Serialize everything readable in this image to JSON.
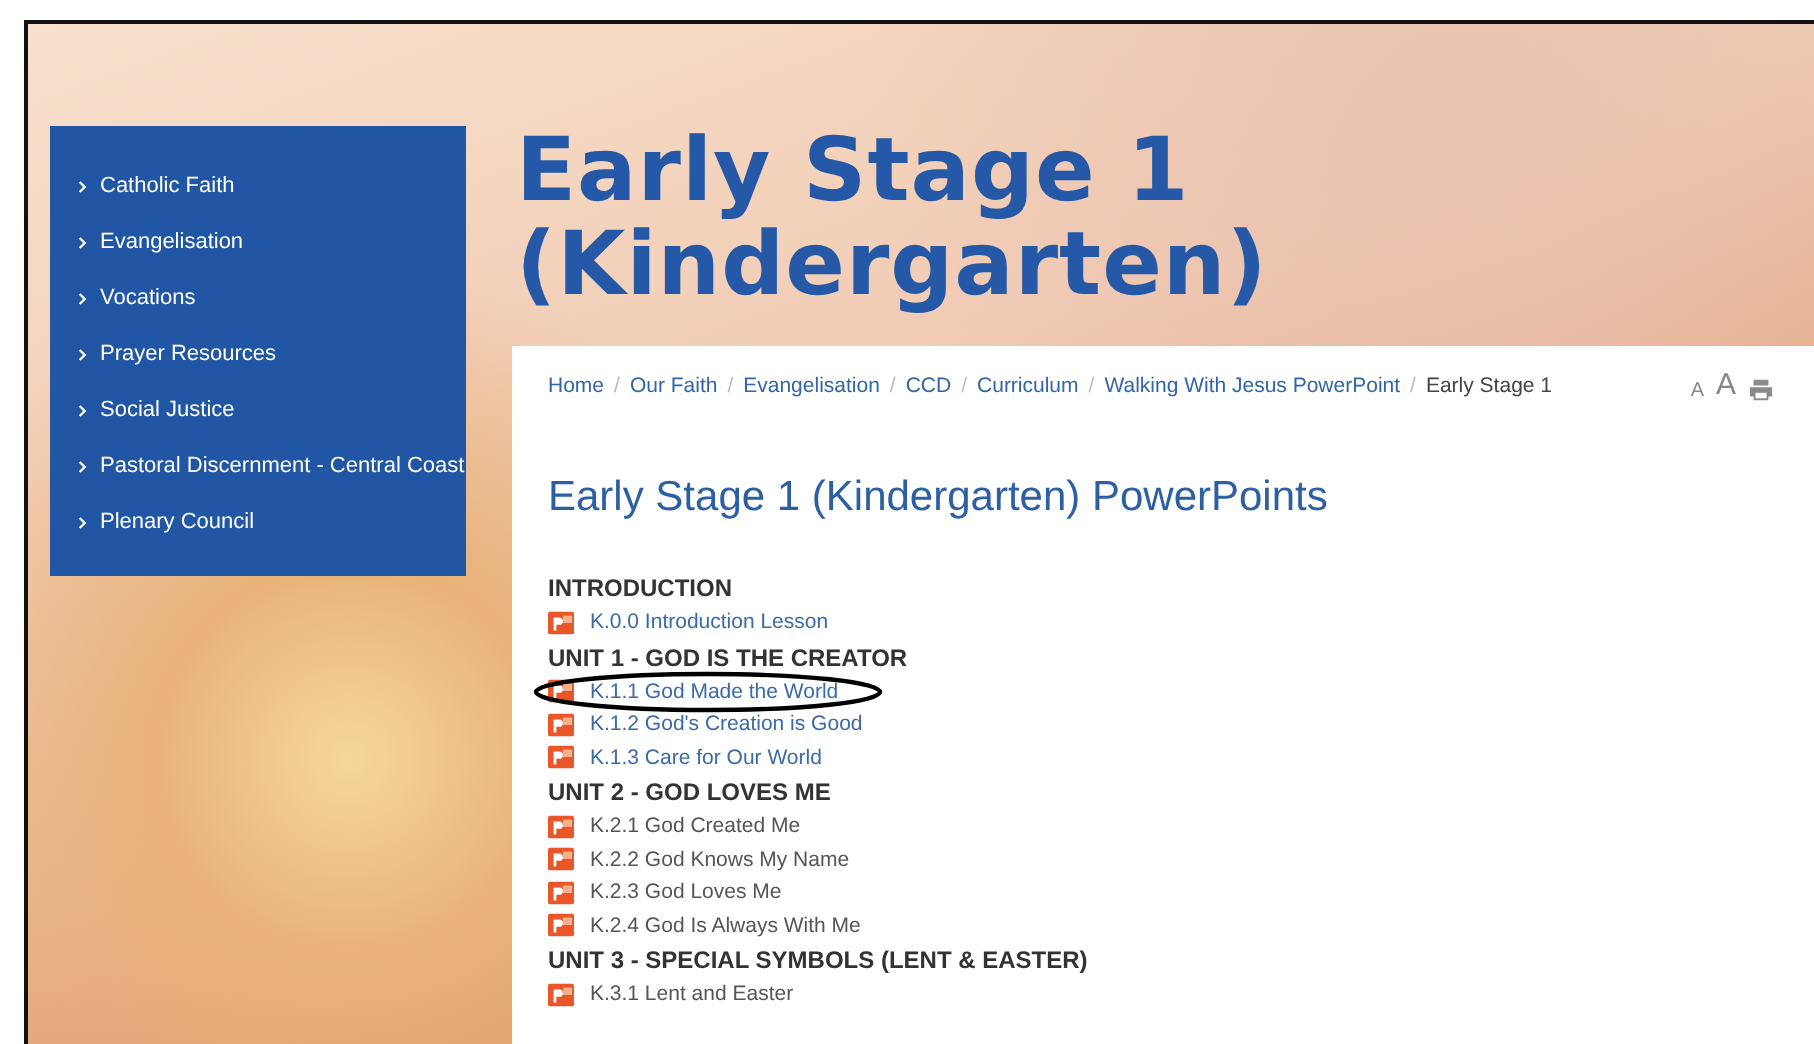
{
  "sidebar": {
    "items": [
      {
        "label": "Catholic Faith"
      },
      {
        "label": "Evangelisation"
      },
      {
        "label": "Vocations"
      },
      {
        "label": "Prayer Resources"
      },
      {
        "label": "Social Justice"
      },
      {
        "label": "Pastoral Discernment - Central Coast"
      },
      {
        "label": "Plenary Council"
      }
    ]
  },
  "page_title": "Early Stage 1 (Kindergarten)",
  "breadcrumb_separator": "/",
  "breadcrumb": [
    {
      "label": "Home",
      "current": false
    },
    {
      "label": "Our Faith",
      "current": false
    },
    {
      "label": "Evangelisation",
      "current": false
    },
    {
      "label": "CCD",
      "current": false
    },
    {
      "label": "Curriculum",
      "current": false
    },
    {
      "label": "Walking With Jesus PowerPoint",
      "current": false
    },
    {
      "label": "Early Stage 1",
      "current": true
    }
  ],
  "text_size_controls": [
    "A",
    "A"
  ],
  "heading": "Early Stage 1 (Kindergarten) PowerPoints",
  "sections": [
    {
      "title": "INTRODUCTION",
      "files": [
        {
          "label": "K.0.0 Introduction Lesson",
          "linked": true,
          "circled": false
        }
      ]
    },
    {
      "title": "UNIT 1 - GOD IS THE CREATOR",
      "files": [
        {
          "label": "K.1.1 God Made the World",
          "linked": true,
          "circled": true
        },
        {
          "label": "K.1.2 God's Creation is Good",
          "linked": true,
          "circled": false
        },
        {
          "label": "K.1.3 Care for Our World",
          "linked": true,
          "circled": false
        }
      ]
    },
    {
      "title": "UNIT 2 - GOD LOVES ME",
      "files": [
        {
          "label": "K.2.1 God Created Me",
          "linked": false,
          "circled": false
        },
        {
          "label": "K.2.2  God Knows My Name",
          "linked": false,
          "circled": false
        },
        {
          "label": "K.2.3 God Loves Me",
          "linked": false,
          "circled": false
        },
        {
          "label": "K.2.4 God Is Always With Me",
          "linked": false,
          "circled": false
        }
      ]
    },
    {
      "title": "UNIT 3 - SPECIAL SYMBOLS (LENT & EASTER)",
      "files": [
        {
          "label": "K.3.1 Lent and Easter",
          "linked": false,
          "circled": false
        }
      ]
    }
  ]
}
